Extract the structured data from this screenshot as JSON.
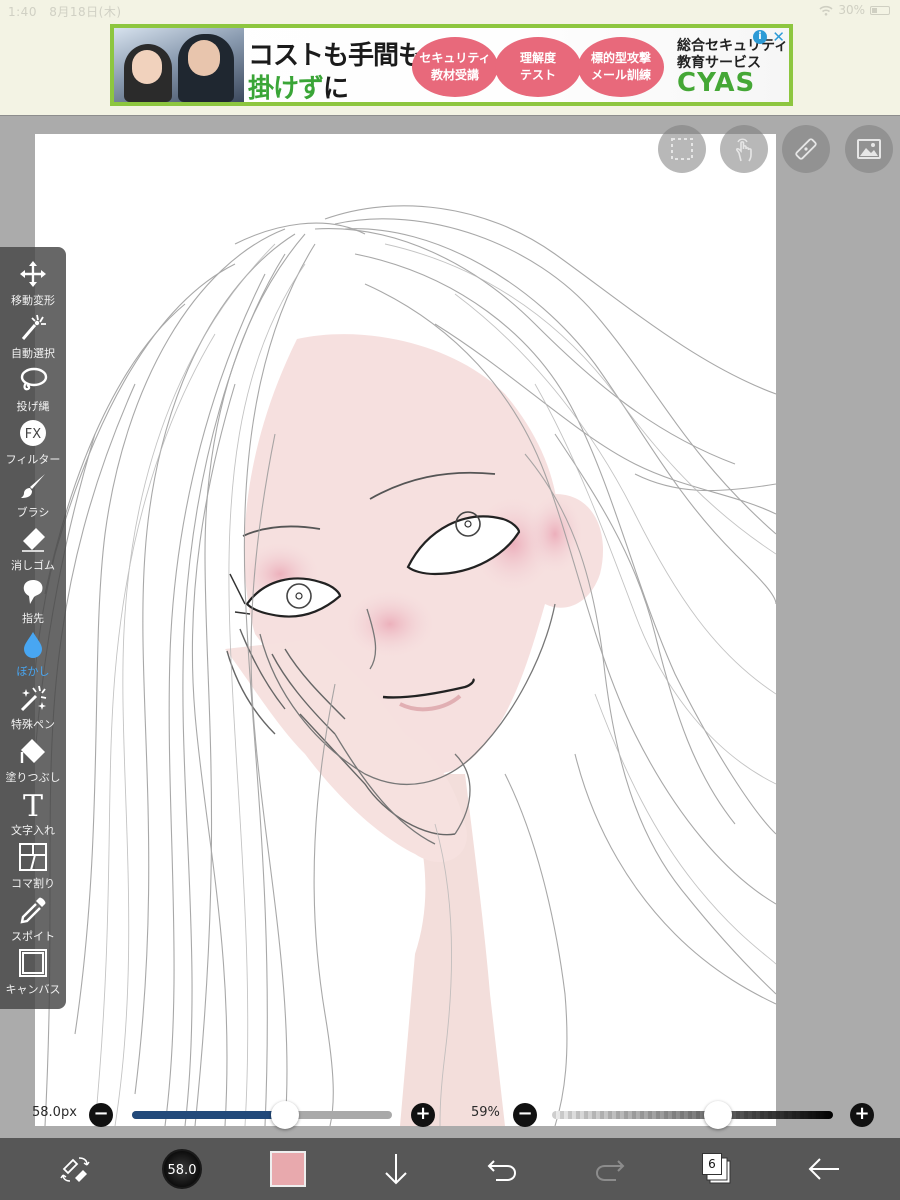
{
  "status": {
    "time": "1:40",
    "date": "8月18日(木)",
    "battery": "30%"
  },
  "ad": {
    "headline1": "コストも手間も",
    "headline2_green": "掛けず",
    "headline2_dark": "に",
    "bubbles": [
      {
        "line1": "セキュリティ",
        "line2": "教材受講"
      },
      {
        "line1": "理解度",
        "line2": "テスト"
      },
      {
        "line1": "標的型攻撃",
        "line2": "メール訓練"
      }
    ],
    "brand_line1": "総合セキュリティ",
    "brand_line2": "教育サービス",
    "brand_name": "CYAS",
    "info_icon": "i",
    "close_icon": "✕"
  },
  "tools": [
    {
      "label": "移動変形",
      "icon": "move-icon"
    },
    {
      "label": "自動選択",
      "icon": "magic-wand-icon"
    },
    {
      "label": "投げ縄",
      "icon": "lasso-icon"
    },
    {
      "label": "フィルター",
      "icon": "fx-icon"
    },
    {
      "label": "ブラシ",
      "icon": "brush-icon"
    },
    {
      "label": "消しゴム",
      "icon": "eraser-icon"
    },
    {
      "label": "指先",
      "icon": "finger-icon"
    },
    {
      "label": "ぼかし",
      "icon": "blur-drop-icon",
      "active": true
    },
    {
      "label": "特殊ペン",
      "icon": "special-pen-icon"
    },
    {
      "label": "塗りつぶし",
      "icon": "fill-icon"
    },
    {
      "label": "文字入れ",
      "icon": "text-icon"
    },
    {
      "label": "コマ割り",
      "icon": "frame-divider-icon"
    },
    {
      "label": "スポイト",
      "icon": "eyedropper-icon"
    },
    {
      "label": "キャンバス",
      "icon": "canvas-icon"
    }
  ],
  "fx_text": "FX",
  "text_tool_glyph": "T",
  "brush": {
    "size_label": "58.0px",
    "size_value": 58.0,
    "size_fraction": 0.59,
    "circle_text": "58.0"
  },
  "opacity": {
    "label": "59%",
    "fraction": 0.59
  },
  "pm": {
    "minus": "−",
    "plus": "+"
  },
  "layers": {
    "count": "6"
  },
  "colors": {
    "accent_blue": "#48a6f2",
    "brush_track": "#22497a",
    "primary_color": "#e8a9ad"
  }
}
